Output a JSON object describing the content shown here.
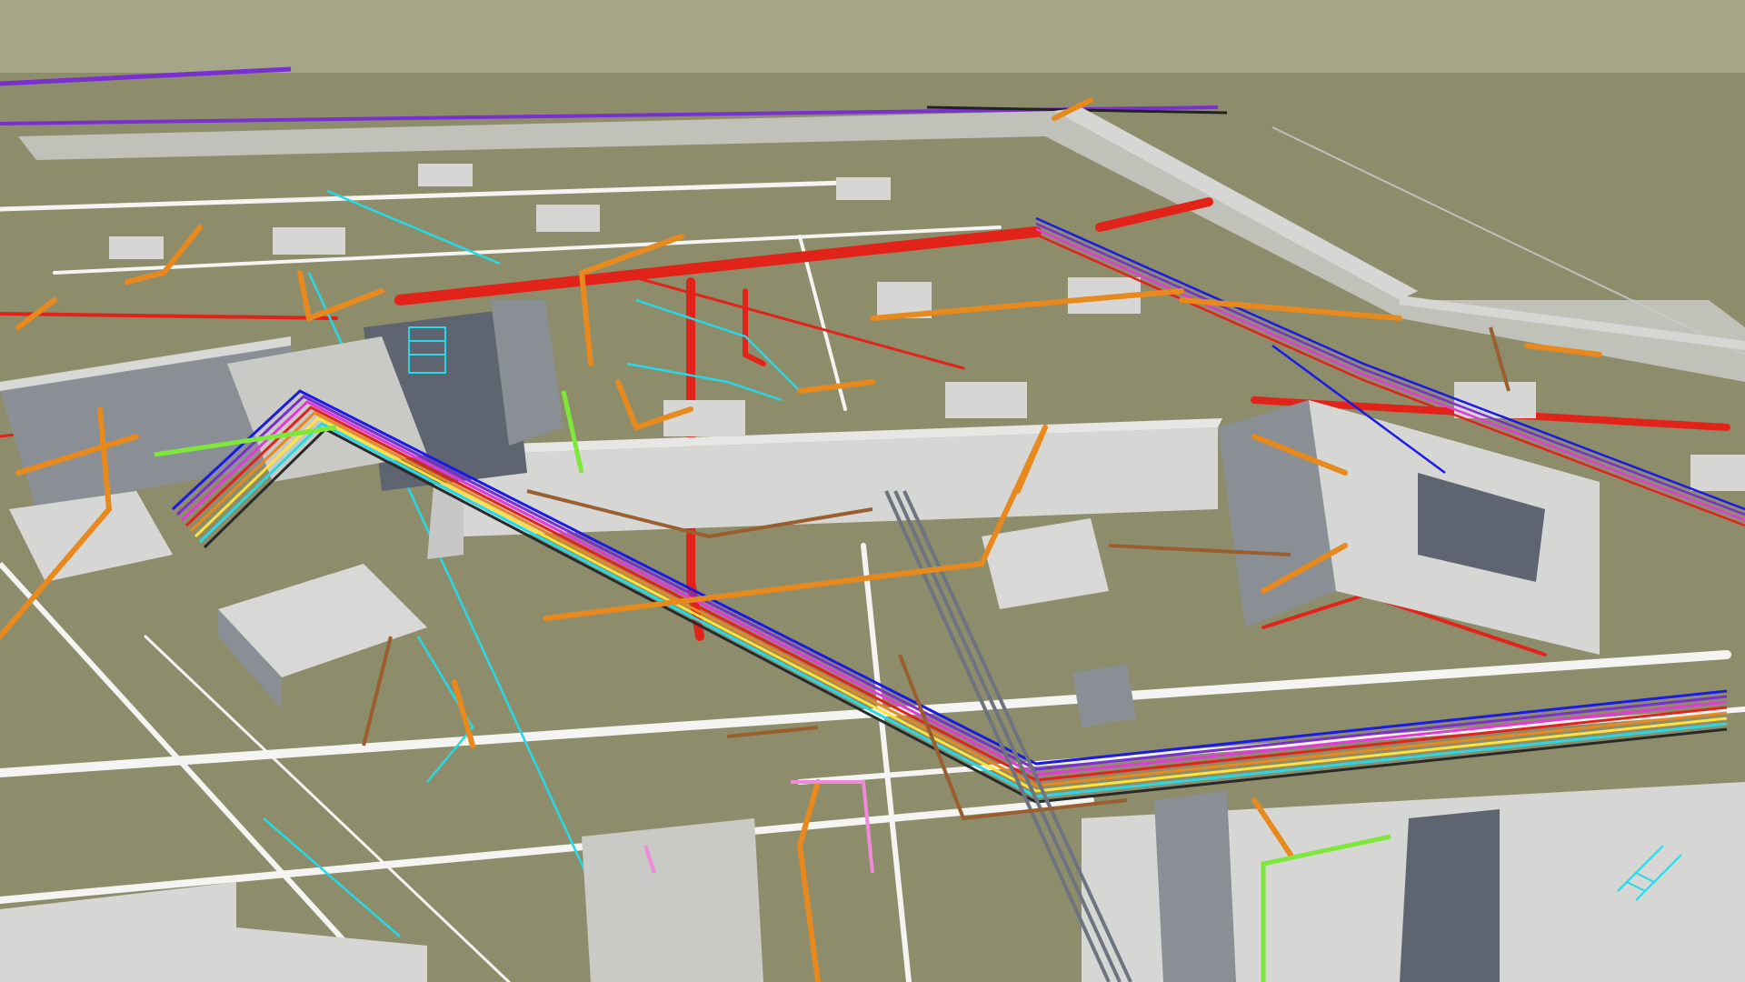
{
  "viewport": {
    "kind": "3d-bim-mep-model-view",
    "colors": {
      "ground": "#8d8d6c",
      "sky": "#a6a689",
      "structure_top": "#d8d8d6",
      "structure_side": "#8a8f95",
      "structure_dark": "#5e6570",
      "pipe_orange": "#e8891d",
      "pipe_brown": "#9b5e2e",
      "pipe_red": "#e2231a",
      "pipe_cyan": "#27d8e6",
      "pipe_purple": "#7a2fd0",
      "pipe_blue": "#1a1ae6",
      "pipe_magenta": "#e23ad8",
      "pipe_white": "#f4f4f2",
      "pipe_green": "#7de83a",
      "pipe_yellow": "#ffe23a",
      "pipe_pink": "#f08ad8",
      "pipe_dark": "#2a2a2a",
      "pipe_gray": "#6d7480"
    }
  }
}
